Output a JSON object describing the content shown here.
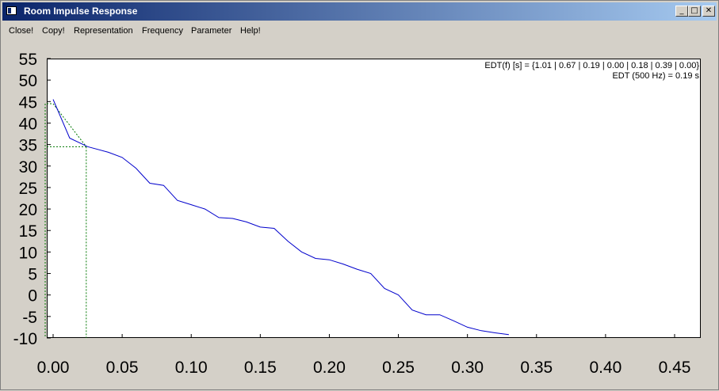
{
  "window": {
    "title": "Room Impulse Response",
    "controls": {
      "minimize": "_",
      "maximize": "□",
      "close": "✕"
    },
    "title_icon": "window-icon"
  },
  "menu": {
    "items": [
      "Close!",
      "Copy!",
      "Representation",
      "Frequency",
      "Parameter",
      "Help!"
    ]
  },
  "annotations": {
    "edt_list": "EDT(f) [s] = {1.01 | 0.67 | 0.19 | 0.00 | 0.18 | 0.39 | 0.00}",
    "edt_single": "EDT (500 Hz) = 0.19 s"
  },
  "chart_data": {
    "type": "line",
    "title": "",
    "xlabel": "",
    "ylabel": "",
    "xlim": [
      0.0,
      0.47
    ],
    "ylim": [
      -10,
      55
    ],
    "xticks": [
      "0.00",
      "0.05",
      "0.10",
      "0.15",
      "0.20",
      "0.25",
      "0.30",
      "0.35",
      "0.40",
      "0.45"
    ],
    "yticks": [
      "55",
      "50",
      "45",
      "40",
      "35",
      "30",
      "25",
      "20",
      "15",
      "10",
      "5",
      "0",
      "-5",
      "-10"
    ],
    "grid": false,
    "series": [
      {
        "color": "#0000cc",
        "x": [
          0.0,
          0.012,
          0.025,
          0.04,
          0.05,
          0.06,
          0.07,
          0.08,
          0.09,
          0.1,
          0.11,
          0.12,
          0.13,
          0.14,
          0.15,
          0.16,
          0.17,
          0.18,
          0.19,
          0.2,
          0.21,
          0.22,
          0.23,
          0.24,
          0.25,
          0.26,
          0.27,
          0.28,
          0.29,
          0.3,
          0.31,
          0.32,
          0.33
        ],
        "y": [
          45.5,
          36.5,
          34.5,
          33.2,
          32.0,
          29.5,
          26.0,
          25.5,
          22.0,
          21.0,
          20.0,
          18.0,
          17.8,
          17.0,
          15.8,
          15.5,
          12.5,
          10.0,
          8.5,
          8.2,
          7.2,
          6.0,
          5.0,
          1.5,
          0.0,
          -3.5,
          -4.6,
          -4.6,
          -6.0,
          -7.5,
          -8.3,
          -8.8,
          -9.2
        ]
      }
    ],
    "edt_guides": {
      "color": "#007700",
      "start": [
        0.0,
        44.5
      ],
      "end": [
        0.024,
        34.5
      ]
    }
  }
}
